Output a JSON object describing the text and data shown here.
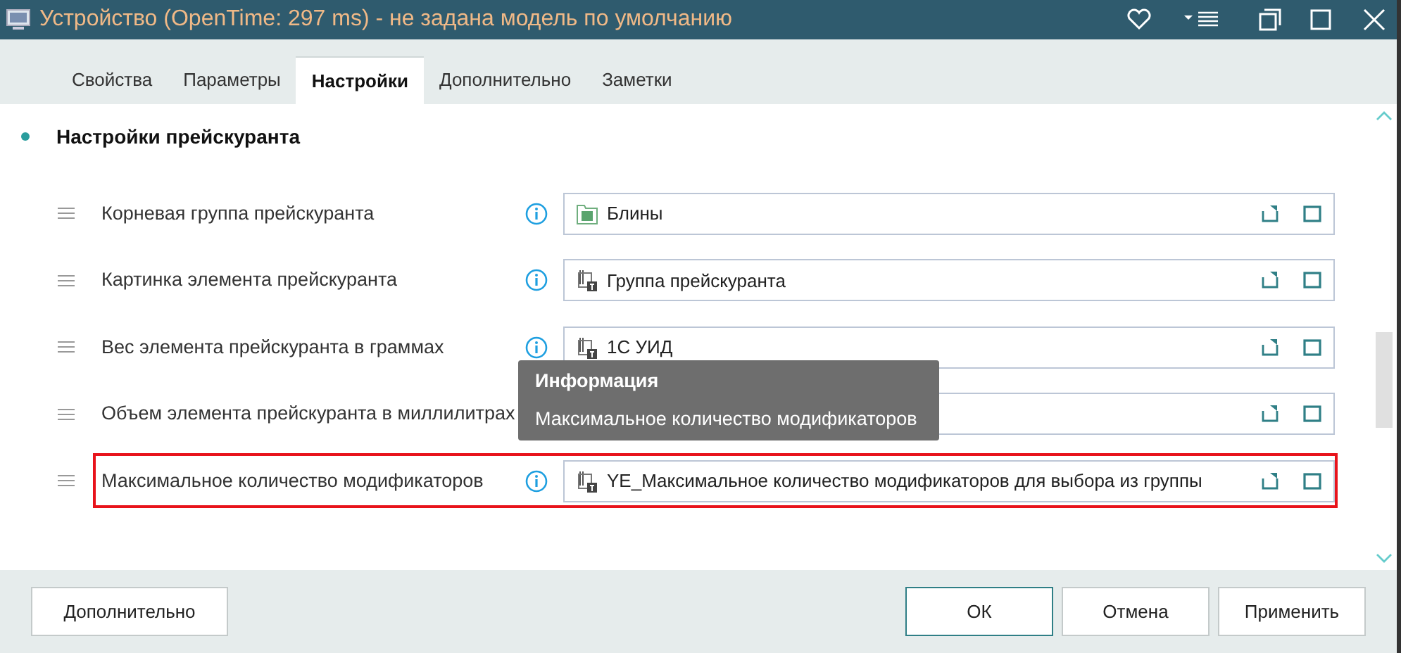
{
  "window": {
    "title": "Устройство (OpenTime: 297 ms) - не задана модель по умолчанию"
  },
  "tabs": [
    {
      "label": "Свойства",
      "selected": false
    },
    {
      "label": "Параметры",
      "selected": false
    },
    {
      "label": "Настройки",
      "selected": true
    },
    {
      "label": "Дополнительно",
      "selected": false
    },
    {
      "label": "Заметки",
      "selected": false
    }
  ],
  "section": {
    "title": "Настройки прейскуранта"
  },
  "rows": [
    {
      "label": "Корневая группа прейскуранта",
      "value": "Блины",
      "kind": "folder",
      "highlighted": false
    },
    {
      "label": "Картинка элемента прейскуранта",
      "value": "Группа прейскуранта",
      "kind": "attribute",
      "highlighted": false
    },
    {
      "label": "Вес элемента прейскуранта в граммах",
      "value": "1С УИД",
      "kind": "attribute",
      "highlighted": false
    },
    {
      "label": "Объем элемента прейскуранта в миллилитрах",
      "highlighted": false
    },
    {
      "label": "Максимальное количество модификаторов",
      "value": "YE_Максимальное количество модификаторов для выбора из группы",
      "kind": "attribute",
      "highlighted": true
    }
  ],
  "tooltip": {
    "title": "Информация",
    "text": "Максимальное количество модификаторов"
  },
  "footer": {
    "left_button": "Дополнительно",
    "buttons": [
      {
        "label": "ОК",
        "default": true
      },
      {
        "label": "Отмена",
        "default": false
      },
      {
        "label": "Применить",
        "default": false
      }
    ]
  }
}
